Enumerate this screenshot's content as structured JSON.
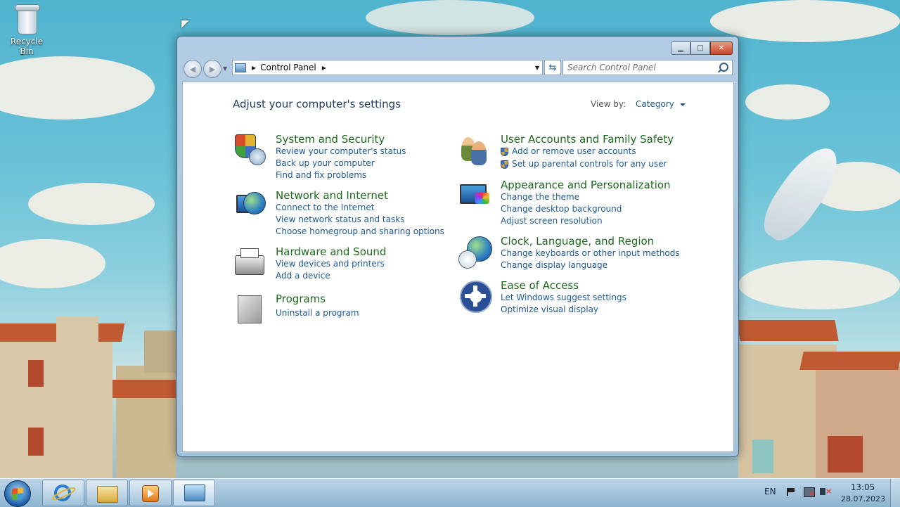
{
  "desktop": {
    "recycle_bin_label": "Recycle Bin"
  },
  "window": {
    "address": {
      "path": [
        "Control Panel"
      ]
    },
    "search": {
      "placeholder": "Search Control Panel"
    },
    "page_title": "Adjust your computer's settings",
    "view_by": {
      "label": "View by:",
      "value": "Category"
    },
    "categories_left": [
      {
        "title": "System and Security",
        "icon": "system-security-icon",
        "links": [
          "Review your computer's status",
          "Back up your computer",
          "Find and fix problems"
        ]
      },
      {
        "title": "Network and Internet",
        "icon": "network-globe-icon",
        "links": [
          "Connect to the Internet",
          "View network status and tasks",
          "Choose homegroup and sharing options"
        ]
      },
      {
        "title": "Hardware and Sound",
        "icon": "printer-icon",
        "links": [
          "View devices and printers",
          "Add a device"
        ]
      },
      {
        "title": "Programs",
        "icon": "programs-box-icon",
        "links": [
          "Uninstall a program"
        ]
      }
    ],
    "categories_right": [
      {
        "title": "User Accounts and Family Safety",
        "icon": "users-icon",
        "links": [
          "Add or remove user accounts",
          "Set up parental controls for any user"
        ]
      },
      {
        "title": "Appearance and Personalization",
        "icon": "monitor-color-icon",
        "links": [
          "Change the theme",
          "Change desktop background",
          "Adjust screen resolution"
        ]
      },
      {
        "title": "Clock, Language, and Region",
        "icon": "clock-globe-icon",
        "links": [
          "Change keyboards or other input methods",
          "Change display language"
        ]
      },
      {
        "title": "Ease of Access",
        "icon": "ease-of-access-icon",
        "links": [
          "Let Windows suggest settings",
          "Optimize visual display"
        ]
      }
    ]
  },
  "taskbar": {
    "language": "EN",
    "time": "13:05",
    "date": "28.07.2023",
    "pinned": [
      "internet-explorer-icon",
      "windows-explorer-icon",
      "media-player-icon",
      "control-panel-icon"
    ]
  }
}
